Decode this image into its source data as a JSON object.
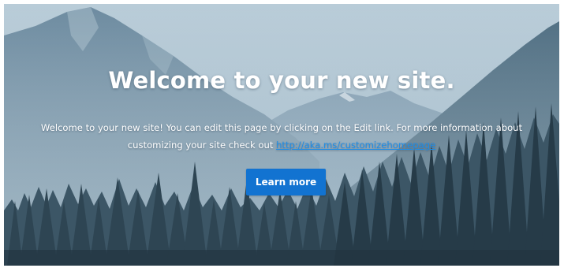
{
  "hero": {
    "title": "Welcome to your new site.",
    "description_text": "Welcome to your new site! You can edit this page by clicking on the Edit link. For more information about customizing your site check out ",
    "link_text": "http://aka.ms/customizehomepage",
    "button_label": "Learn more",
    "background": "mountain-forest-landscape-image"
  },
  "colors": {
    "button_bg": "#1273d1",
    "link": "#1f8de6",
    "text": "#ffffff",
    "sky": "#a9c2d0",
    "forest": "#2c4250"
  }
}
